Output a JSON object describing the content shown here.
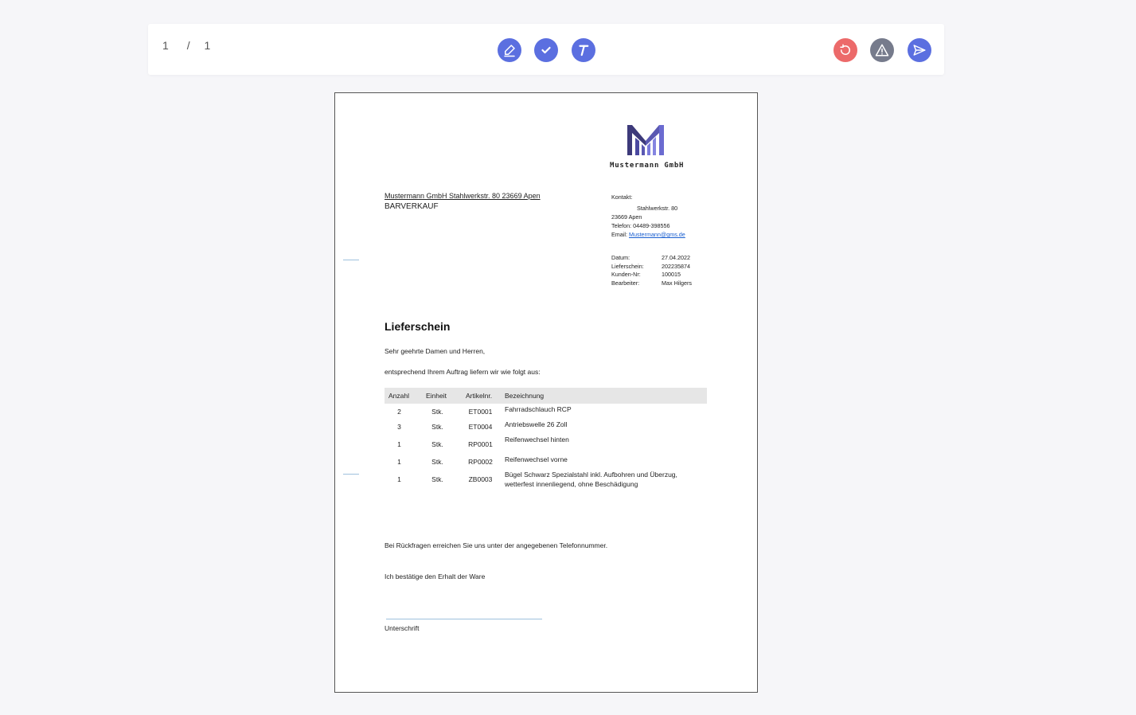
{
  "toolbar": {
    "page_current": "1",
    "page_separator": "/",
    "page_total": "1",
    "buttons": [
      {
        "name": "sign-button",
        "icon": "pen-icon",
        "color": "#5b6fe0"
      },
      {
        "name": "confirm-button",
        "icon": "check-icon",
        "color": "#5b6fe0"
      },
      {
        "name": "text-button",
        "icon": "text-icon",
        "color": "#5b6fe0"
      },
      {
        "name": "reset-button",
        "icon": "reset-icon",
        "color": "#ec6a6a"
      },
      {
        "name": "report-button",
        "icon": "warning-icon",
        "color": "#767b8c"
      },
      {
        "name": "send-button",
        "icon": "send-icon",
        "color": "#5b6fe0"
      }
    ]
  },
  "document": {
    "company_name": "Mustermann GmbH",
    "sender_line": "Mustermann GmbH Stahlwerkstr. 80 23669 Apen",
    "recipient": "BARVERKAUF",
    "contact": {
      "label": "Kontakt:",
      "street": "Stahlwerkstr. 80",
      "city": "23669 Apen",
      "phone": "Telefon: 04489-398556",
      "email_label": "Email:",
      "email": "Mustermann@gms.de"
    },
    "meta": [
      {
        "key": "Datum:",
        "value": "27.04.2022"
      },
      {
        "key": "Lieferschein:",
        "value": "202235874"
      },
      {
        "key": "Kunden-Nr:",
        "value": "100015"
      },
      {
        "key": "Bearbeiter:",
        "value": "Max Hilgers"
      }
    ],
    "title": "Lieferschein",
    "greeting": "Sehr geehrte Damen und Herren,",
    "intro": "entsprechend Ihrem Auftrag liefern wir wie folgt aus:",
    "table": {
      "headers": [
        "Anzahl",
        "Einheit",
        "Artikelnr.",
        "Bezeichnung"
      ],
      "rows": [
        {
          "anzahl": "2",
          "einheit": "Stk.",
          "artikel": "ET0001",
          "bezeichnung": "Fahrradschlauch RCP"
        },
        {
          "anzahl": "3",
          "einheit": "Stk.",
          "artikel": "ET0004",
          "bezeichnung": "Antriebswelle 26 Zoll"
        },
        {
          "anzahl": "1",
          "einheit": "Stk.",
          "artikel": "RP0001",
          "bezeichnung": "Reifenwechsel hinten"
        },
        {
          "anzahl": "1",
          "einheit": "Stk.",
          "artikel": "RP0002",
          "bezeichnung": "Reifenwechsel vorne"
        },
        {
          "anzahl": "1",
          "einheit": "Stk.",
          "artikel": "ZB0003",
          "bezeichnung": "Bügel Schwarz Spezialstahl inkl. Aufbohren und Überzug, wetterfest innenliegend, ohne Beschädigung"
        }
      ]
    },
    "footer_question": "Bei Rückfragen erreichen Sie uns unter der angegebenen Telefonnummer.",
    "confirmation": "Ich bestätige den Erhalt der Ware",
    "signature_label": "Unterschrift"
  }
}
